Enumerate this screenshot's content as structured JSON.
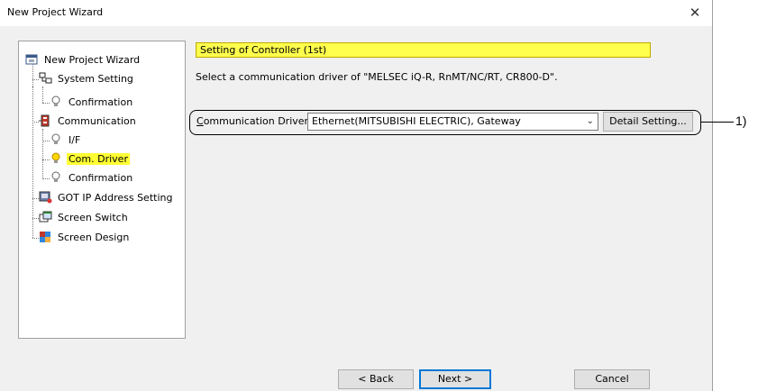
{
  "window": {
    "title": "New Project Wizard"
  },
  "tree": {
    "items": [
      {
        "label": "New Project Wizard",
        "icon": "wizard-icon"
      },
      {
        "label": "System Setting",
        "icon": "system-setting-icon"
      },
      {
        "label": "Confirmation",
        "icon": "bulb-icon"
      },
      {
        "label": "Communication",
        "icon": "communication-icon"
      },
      {
        "label": "I/F",
        "icon": "bulb-icon"
      },
      {
        "label": "Com. Driver",
        "icon": "bulb-lit-icon",
        "selected": true
      },
      {
        "label": "Confirmation",
        "icon": "bulb-icon"
      },
      {
        "label": "GOT IP Address Setting",
        "icon": "ip-address-icon"
      },
      {
        "label": "Screen Switch",
        "icon": "screen-switch-icon"
      },
      {
        "label": "Screen Design",
        "icon": "screen-design-icon"
      }
    ]
  },
  "main": {
    "header": "Setting of Controller (1st)",
    "instruction": "Select a communication driver of \"MELSEC iQ-R, RnMT/NC/RT, CR800-D\".",
    "driver_label": "Communication Driver:",
    "driver_value": "Ethernet(MITSUBISHI ELECTRIC), Gateway",
    "detail_button": "Detail Setting..."
  },
  "buttons": {
    "back": "< Back",
    "next": "Next >",
    "cancel": "Cancel"
  },
  "callout": "1)",
  "colors": {
    "highlight": "#ffff33",
    "default_button_border": "#0078d7"
  }
}
